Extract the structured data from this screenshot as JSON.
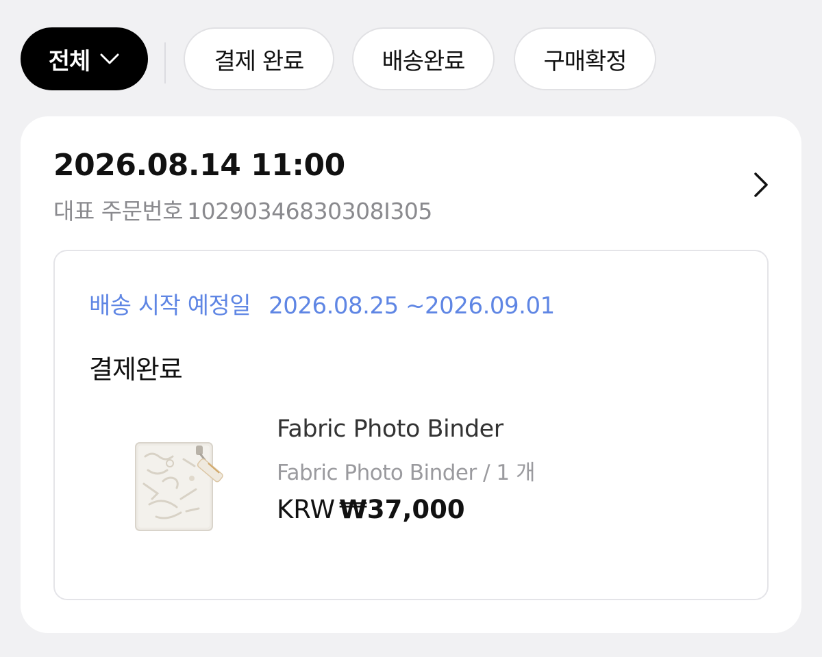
{
  "filters": {
    "all_label": "전체",
    "chips": [
      "결제 완료",
      "배송완료",
      "구매확정"
    ]
  },
  "order": {
    "date": "2026.08.14 11:00",
    "number_label": "대표 주문번호",
    "number": "10290346830308I305"
  },
  "shipping": {
    "label": "배송 시작 예정일",
    "dates": "2026.08.25 ~2026.09.01"
  },
  "status": "결제완료",
  "product": {
    "name": "Fabric Photo Binder",
    "option": "Fabric Photo Binder / 1 개",
    "currency": "KRW",
    "price": "₩37,000"
  },
  "icons": {
    "dropdown": "chevron-down-icon",
    "detail": "chevron-right-icon"
  },
  "colors": {
    "accent_blue": "#5f86e4",
    "active_chip": "#000000",
    "background": "#f1f1f3"
  }
}
